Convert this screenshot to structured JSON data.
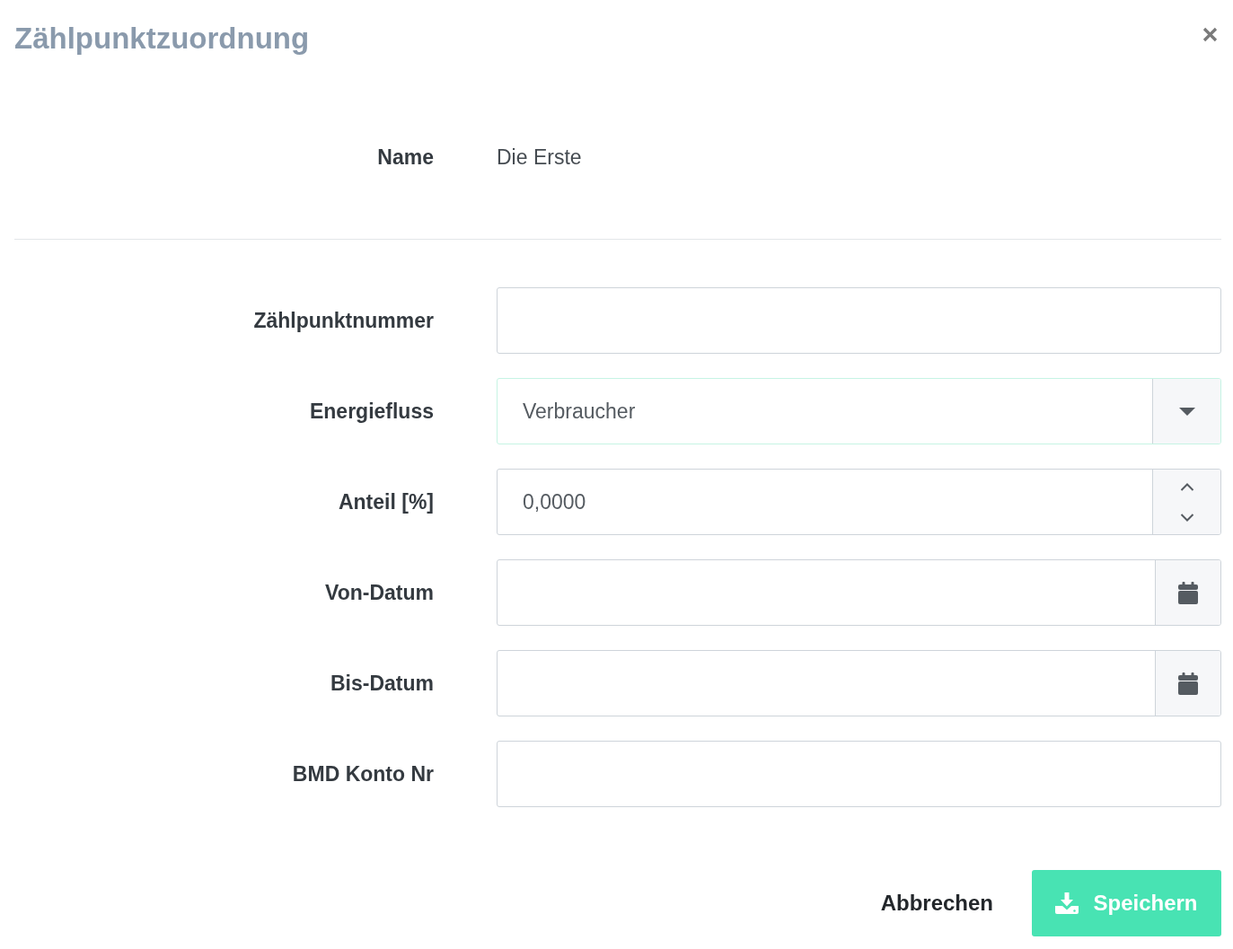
{
  "dialog": {
    "title": "Zählpunktzuordnung"
  },
  "name_row": {
    "label": "Name",
    "value": "Die Erste"
  },
  "fields": [
    {
      "label": "Zählpunktnummer",
      "kind": "text"
    },
    {
      "label": "Energiefluss",
      "kind": "select",
      "value": "Verbraucher",
      "focused": true
    },
    {
      "label": "Anteil [%]",
      "kind": "number",
      "value": "0,0000"
    },
    {
      "label": "Von-Datum",
      "kind": "date"
    },
    {
      "label": "Bis-Datum",
      "kind": "date"
    },
    {
      "label": "BMD Konto Nr",
      "kind": "text"
    }
  ],
  "buttons": [
    {
      "label": "Abbrechen",
      "kind": "cancel"
    },
    {
      "label": "Speichern",
      "kind": "save"
    }
  ]
}
